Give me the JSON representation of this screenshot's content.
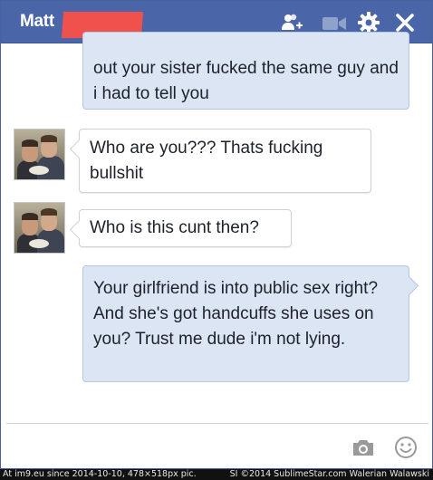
{
  "header": {
    "contact_name": "Matt",
    "icons": [
      "add-friend-icon",
      "video-call-icon",
      "gear-icon",
      "close-icon"
    ],
    "colors": {
      "bar": "#4a65a8",
      "redaction": "#f0514d"
    }
  },
  "messages": [
    {
      "direction": "outgoing",
      "text": "out your sister fucked the same guy and i had to tell you"
    },
    {
      "direction": "incoming",
      "text": "Who are you??? Thats fucking bullshit"
    },
    {
      "direction": "incoming",
      "text": "Who is this cunt then?"
    },
    {
      "direction": "outgoing",
      "text": "Your girlfriend is into public sex right? And she's got handcuffs she uses on you? Trust me dude i'm not lying."
    }
  ],
  "composer": {
    "value": "",
    "icons": [
      "camera-icon",
      "emoji-icon"
    ]
  },
  "watermark": {
    "left": "At im9.eu since 2014-10-10, 478×518px pic.",
    "right": "SI ©2014 SublimeStar.com Walerian Walawski"
  },
  "colors": {
    "outgoing_bubble": "#dbe5f4",
    "incoming_bubble": "#ffffff"
  }
}
